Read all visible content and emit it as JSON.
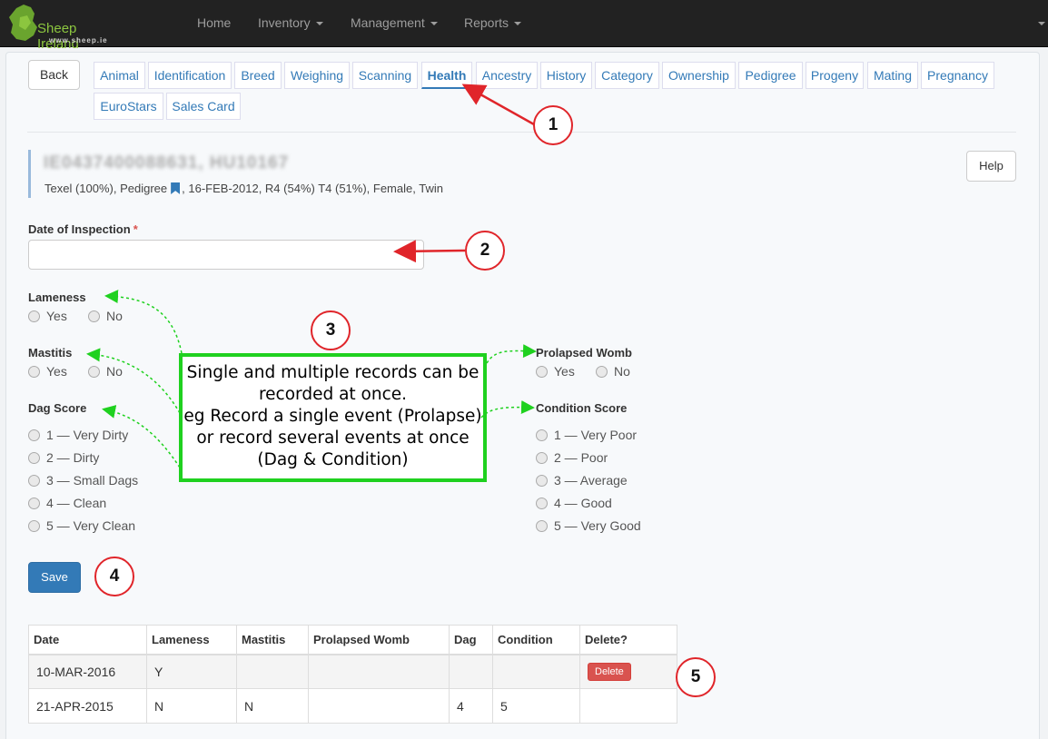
{
  "nav": {
    "brand": "Sheep Ireland",
    "brand_sub": "www.sheep.ie",
    "home": "Home",
    "inventory": "Inventory",
    "management": "Management",
    "reports": "Reports"
  },
  "back_label": "Back",
  "help_label": "Help",
  "tabs": [
    "Animal",
    "Identification",
    "Breed",
    "Weighing",
    "Scanning",
    "Health",
    "Ancestry",
    "History",
    "Category",
    "Ownership",
    "Pedigree",
    "Progeny",
    "Mating",
    "Pregnancy",
    "EuroStars",
    "Sales Card"
  ],
  "active_tab": "Health",
  "animal": {
    "id": "IE0437400088631, HU10167",
    "breed": "Texel (100%), Pedigree",
    "details": "16-FEB-2012, R4 (54%) T4 (51%), Female, Twin"
  },
  "form": {
    "date_label": "Date of Inspection",
    "required_mark": "*",
    "date_value": "",
    "lameness": {
      "label": "Lameness",
      "options": [
        "Yes",
        "No"
      ]
    },
    "mastitis": {
      "label": "Mastitis",
      "options": [
        "Yes",
        "No"
      ]
    },
    "dag": {
      "label": "Dag Score",
      "options": [
        "1 — Very Dirty",
        "2 — Dirty",
        "3 — Small Dags",
        "4 — Clean",
        "5 — Very Clean"
      ]
    },
    "prolapsed": {
      "label": "Prolapsed Womb",
      "options": [
        "Yes",
        "No"
      ]
    },
    "condition": {
      "label": "Condition Score",
      "options": [
        "1 — Very Poor",
        "2 — Poor",
        "3 — Average",
        "4 — Good",
        "5 — Very Good"
      ]
    },
    "save_label": "Save"
  },
  "annotation": {
    "lines": [
      "Single and multiple records can be",
      "recorded at once.",
      "eg Record a single event (Prolapse)",
      "or record several events at once",
      "(Dag & Condition)"
    ],
    "callouts": [
      "1",
      "2",
      "3",
      "4",
      "5"
    ],
    "arrow_red": "#e0252a",
    "arrow_green": "#1fd11f"
  },
  "table": {
    "headers": [
      "Date",
      "Lameness",
      "Mastitis",
      "Prolapsed Womb",
      "Dag",
      "Condition",
      "Delete?"
    ],
    "rows": [
      [
        "10-MAR-2016",
        "Y",
        "",
        "",
        "",
        "",
        ""
      ],
      [
        "21-APR-2015",
        "N",
        "N",
        "",
        "4",
        "5",
        ""
      ]
    ],
    "delete_label": "Delete"
  },
  "colors": {
    "primary": "#337ab7",
    "danger": "#d9534f",
    "navbar": "#222222"
  }
}
